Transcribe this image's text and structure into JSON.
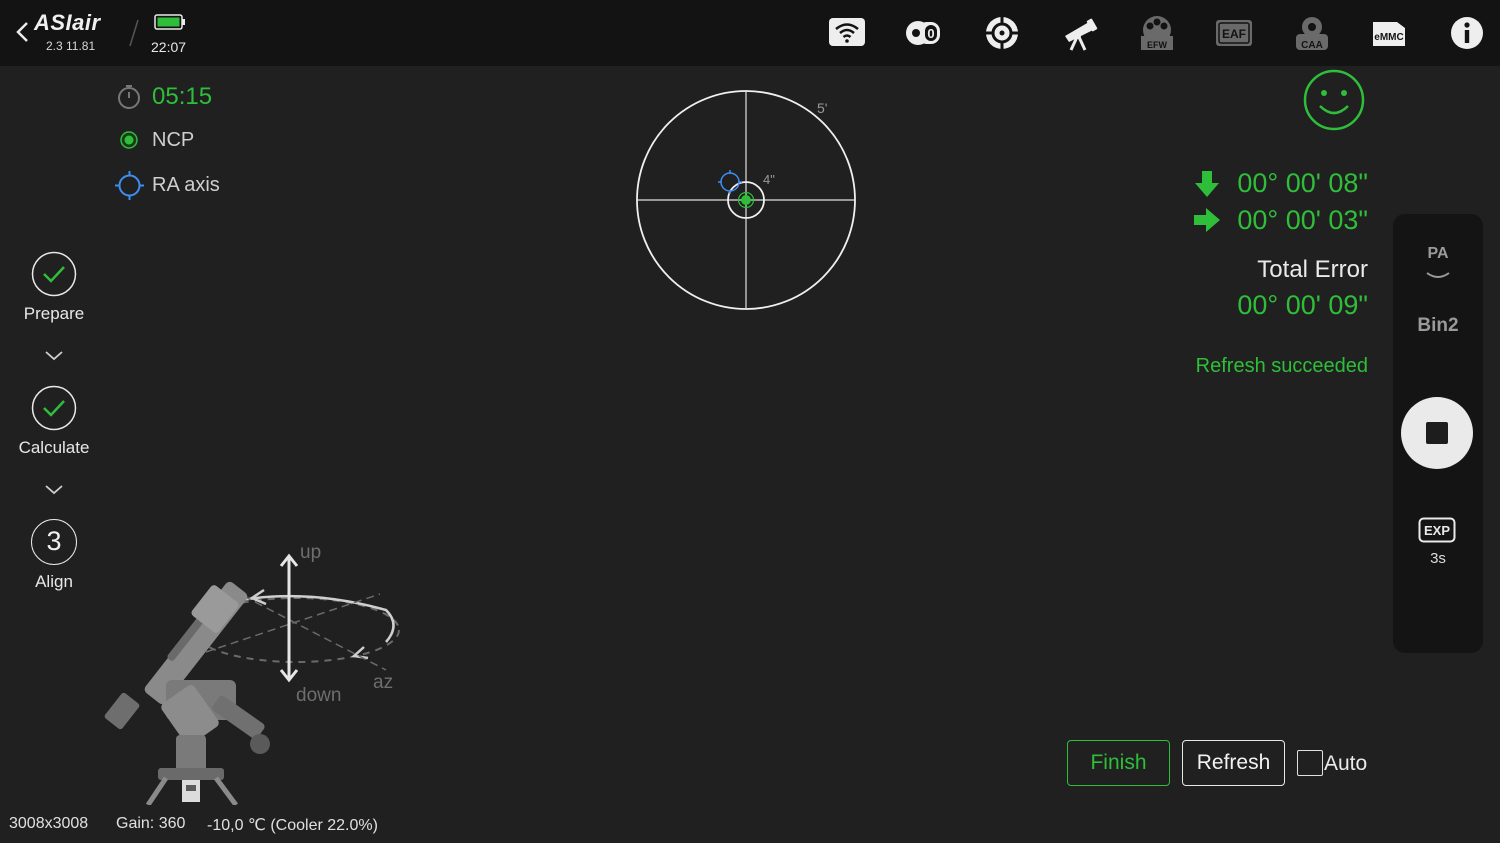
{
  "topbar": {
    "app_name": "ASIair",
    "version": "2.3 11.81",
    "clock": "22:07",
    "status_icons": [
      "wifi-icon",
      "camera-zero-icon",
      "guide-scope-icon",
      "telescope-icon",
      "efw-icon",
      "eaf-icon",
      "caa-icon",
      "emmc-icon",
      "info-icon"
    ],
    "efw_label": "EFW",
    "eaf_label": "EAF",
    "caa_label": "CAA",
    "emmc_label": "eMMC"
  },
  "status": {
    "timer": "05:15",
    "ncp": "NCP",
    "ra_axis": "RA axis"
  },
  "steps": [
    {
      "label": "Prepare",
      "state": "done"
    },
    {
      "label": "Calculate",
      "state": "done"
    },
    {
      "label": "Align",
      "number": "3",
      "state": "current"
    }
  ],
  "target": {
    "outer_label": "5'",
    "inner_label": "4\""
  },
  "errors": {
    "alt_error": "00° 00' 08\"",
    "az_error": "00° 00' 03\"",
    "total_label": "Total Error",
    "total_value": "00° 00' 09\"",
    "status_text": "Refresh succeeded"
  },
  "side_panel": {
    "pa_label": "PA",
    "bin_label": "Bin2",
    "exp_label": "EXP",
    "exp_value": "3s"
  },
  "actions": {
    "finish_label": "Finish",
    "refresh_label": "Refresh",
    "auto_label": "Auto",
    "auto_checked": false
  },
  "illustration": {
    "up_label": "up",
    "down_label": "down",
    "az_label": "az"
  },
  "footer": {
    "resolution": "3008x3008",
    "gain": "Gain: 360",
    "temperature": "-10,0 ℃ (Cooler 22.0%)"
  },
  "colors": {
    "accent_green": "#2fbe3a",
    "background": "#202020",
    "topbar": "#131313",
    "ra_blue": "#3d8ef0"
  }
}
